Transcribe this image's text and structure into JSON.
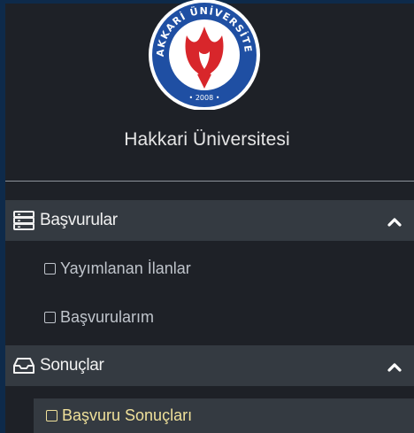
{
  "sidebar": {
    "logo": {
      "ring_text": "HAKKARİ ÜNİVERSİTESİ",
      "year": "2008",
      "colors": {
        "ring": "#1f4fa3",
        "emblem": "#d8262b"
      }
    },
    "university_name": "Hakkari Üniversitesi",
    "sections": [
      {
        "label": "Başvurular",
        "icon": "server-stack-icon",
        "expanded": true,
        "items": [
          {
            "label": "Yayımlanan İlanlar",
            "active": false
          },
          {
            "label": "Başvurularım",
            "active": false
          }
        ]
      },
      {
        "label": "Sonuçlar",
        "icon": "inbox-tray-icon",
        "expanded": true,
        "items": [
          {
            "label": "Başvuru Sonuçları",
            "active": true
          }
        ]
      }
    ],
    "colors": {
      "background": "#1e2127",
      "section_header": "#343a41",
      "active_text": "#efe09a",
      "item_text": "#bfc4cb"
    }
  }
}
